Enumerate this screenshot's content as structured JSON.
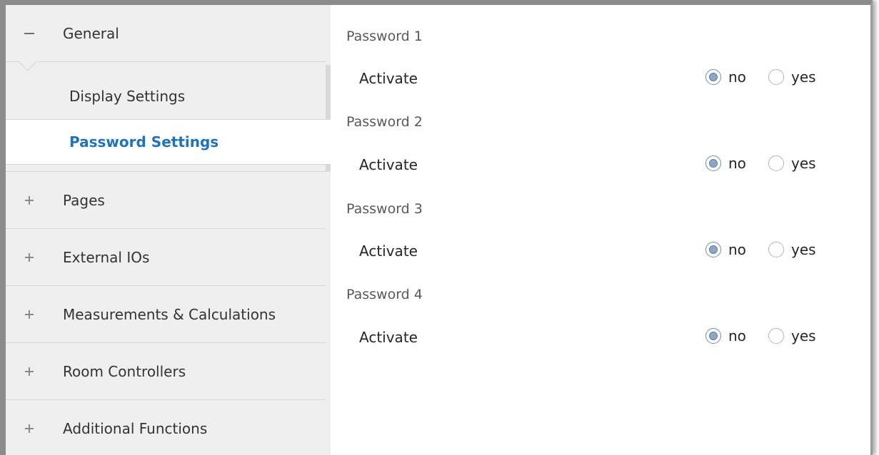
{
  "sidebar": {
    "general": {
      "label": "General",
      "icon": "minus-icon"
    },
    "sub_items": [
      {
        "label": "Display Settings",
        "active": false
      },
      {
        "label": "Password Settings",
        "active": true
      }
    ],
    "sections": [
      {
        "label": "Pages",
        "icon": "plus-icon"
      },
      {
        "label": "External IOs",
        "icon": "plus-icon"
      },
      {
        "label": "Measurements & Calculations",
        "icon": "plus-icon"
      },
      {
        "label": "Room Controllers",
        "icon": "plus-icon"
      },
      {
        "label": "Additional Functions",
        "icon": "plus-icon"
      }
    ]
  },
  "content": {
    "groups": [
      {
        "title": "Password 1",
        "row_label": "Activate",
        "options": [
          "no",
          "yes"
        ],
        "selected": "no"
      },
      {
        "title": "Password 2",
        "row_label": "Activate",
        "options": [
          "no",
          "yes"
        ],
        "selected": "no"
      },
      {
        "title": "Password 3",
        "row_label": "Activate",
        "options": [
          "no",
          "yes"
        ],
        "selected": "no"
      },
      {
        "title": "Password 4",
        "row_label": "Activate",
        "options": [
          "no",
          "yes"
        ],
        "selected": "no"
      }
    ]
  },
  "colors": {
    "active_text": "#1e73be",
    "sidebar_bg": "#efefef",
    "radio_checked": "#8ea6c2"
  }
}
